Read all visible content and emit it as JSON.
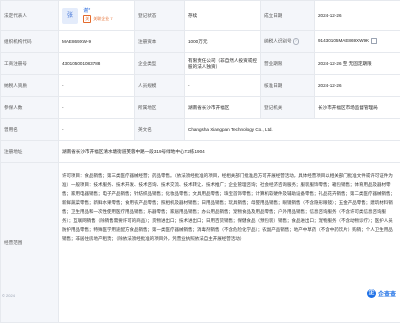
{
  "labels": {
    "legal_rep": "法定代表人",
    "status": "登记状态",
    "established": "成立日期",
    "org_code": "组织机构代码",
    "reg_capital": "注册资本",
    "reg_no": "工商注册号",
    "tax_id": "纳税人识别号",
    "company_type": "企业类型",
    "business_term": "营业期限",
    "taxpayer_qual": "纳税人资质",
    "staff": "人员规模",
    "approval_date": "核准日期",
    "insured": "参保人数",
    "region": "所属地区",
    "authority": "登记机关",
    "former_name": "曾用名",
    "english_name": "英文名",
    "reg_address": "注册地址",
    "scope": "经营范围"
  },
  "values": {
    "legal_rep_avatar": "张",
    "legal_rep_name": "谢*",
    "legal_rep_sub_badge": "关",
    "legal_rep_sub_text": "关联企业 7",
    "status": "存续",
    "established": "2024-12-26",
    "org_code": "MAE869XW-9",
    "reg_capital": "1000万元",
    "reg_no": "430105001083788",
    "tax_id": "91430105MAE869XW9K",
    "company_type": "有限责任公司（非自然人投资或控股的法人独资）",
    "business_term": "2024-12-26 至 无固定期限",
    "taxpayer_qual": "-",
    "staff": "-",
    "approval_date": "2024-12-26",
    "insured": "-",
    "region": "湖南省长沙市开福区",
    "authority": "长沙市开福区市场监督管理局",
    "former_name": "-",
    "english_name": "Changsha Xiangpan Technology Co., Ltd.",
    "reg_address": "湖南省长沙市开福区清水塘街道芙蓉中路一段319号绿地中心T2栋1904",
    "scope": "许可项目：食品销售；第三类医疗器械经营；药品零售。（依法须经批准的项目，经相关部门批准后方可开展经营活动，具体经营项目以相关部门批准文件或许可证件为准）一般项目：技术服务、技术开发、技术咨询、技术交流、技术转让、技术推广；企业管理咨询；社会经济咨询服务；服装服饰零售；箱包销售；体育用品及器材零售；家用电器销售；电子产品销售；针纺织品销售；化妆品零售；文具用品零售；珠宝首饰零售；计算机软硬件及辅助设备零售；礼品花卉销售；第二类医疗器械销售；新鲜蔬菜零售；新鲜水果零售；食用农产品零售；照相机及器材销售；日用品销售；玩具销售；母婴用品销售；眼镜销售（不含隐形眼镜）；五金产品零售；建筑材料销售；卫生用品和一次性使用医疗用品销售；乐器零售；家居用品销售；办公用品销售；宠物食品及用品零售；户外用品销售；信息咨询服务（不含许可类信息咨询服务）；互联网销售（除销售需要许可的商品）；货物进出口；技术进出口；日用百货销售；保健食品（预包装）销售；食品进出口；宠物服务（不含动物诊疗）；医护人员防护用品零售；特殊医学用途配方食品销售；第一类医疗器械销售；消毒剂销售（不含危险化学品）；农副产品销售；地产中草药（不含中药饮片）购销；个人卫生用品销售；非居住房地产租赁；（除依法须经批准的项目外，凭营业执照依法自主开展经营活动）"
  },
  "footer": {
    "left_text": "© 2024",
    "logo_text": "企查查",
    "logo_mark": "企"
  },
  "icons": {
    "help": "question-circle",
    "copy": "copy"
  },
  "colors": {
    "label_bg": "#f4f6fa",
    "border": "#e6e9ee",
    "link": "#2c6cde",
    "accent": "#e46a2b",
    "brand": "#1c6fe6"
  }
}
